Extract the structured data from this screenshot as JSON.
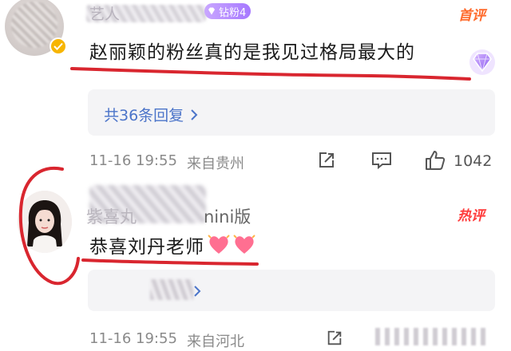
{
  "comments": [
    {
      "username": "艺人",
      "fan_badge": "钻粉4",
      "tag": "首评",
      "text": "赵丽颖的粉丝真的是我见过格局最大的",
      "reply_link": "共36条回复",
      "time": "11-16 19:55",
      "location": "来自贵州",
      "like_count": "1042"
    },
    {
      "username": "紫喜丸",
      "username_suffix": "nini版",
      "tag": "热评",
      "text": "恭喜刘丹老师",
      "time": "11-16 19:55",
      "location": "来自河北"
    }
  ],
  "colors": {
    "tag_first": "#ff6a2b",
    "tag_hot": "#ff3b3b",
    "reply_link": "#4b74c9",
    "annotation_red": "#d9262f"
  },
  "icons": [
    "verified-icon",
    "gem-icon",
    "chevron-right-icon",
    "share-icon",
    "comment-icon",
    "like-icon",
    "heart-emoji-icon"
  ]
}
